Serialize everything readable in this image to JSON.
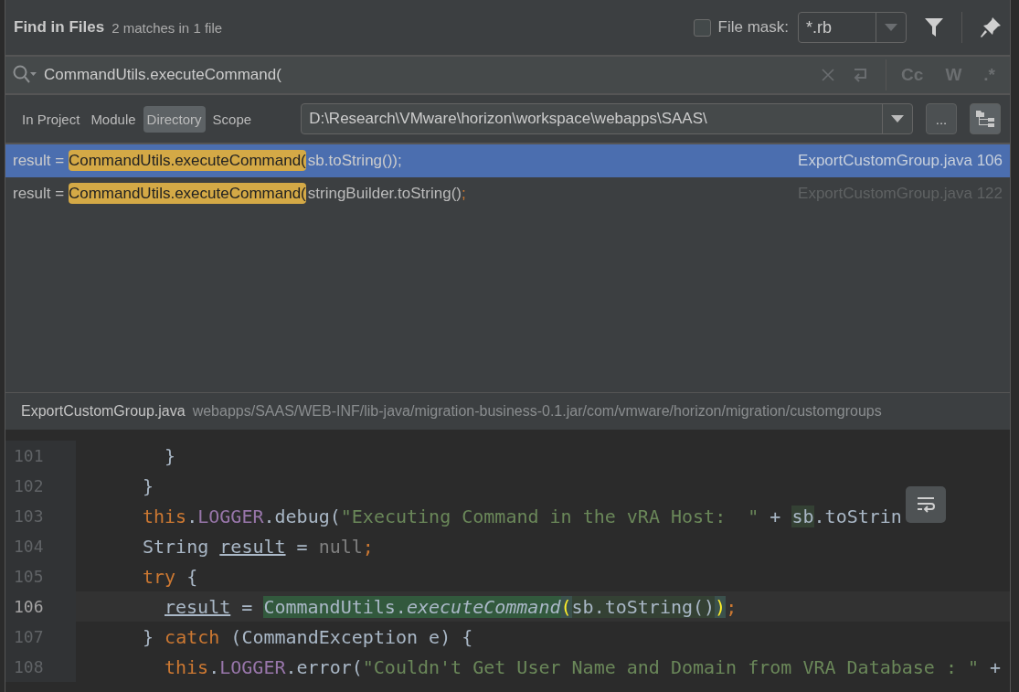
{
  "dialog": {
    "title": "Find in Files",
    "summary": "2 matches in 1 file"
  },
  "file_mask": {
    "checked": false,
    "label": "File mask:",
    "value": "*.rb"
  },
  "search": {
    "value": "CommandUtils.executeCommand(",
    "options": [
      {
        "label": "Cc",
        "selected": false
      },
      {
        "label": "W",
        "selected": false
      },
      {
        "label": ".*",
        "selected": false
      }
    ]
  },
  "scopes": [
    {
      "label": "In Project",
      "selected": false
    },
    {
      "label": "Module",
      "selected": false
    },
    {
      "label": "Directory",
      "selected": true
    },
    {
      "label": "Scope",
      "selected": false
    }
  ],
  "directory": {
    "value": "D:\\Research\\VMware\\horizon\\workspace\\webapps\\SAAS\\",
    "browse_label": "..."
  },
  "results": [
    {
      "prefix": "result = ",
      "match": "CommandUtils.executeCommand(",
      "rest": "sb.toString());",
      "location": "ExportCustomGroup.java 106",
      "selected": true
    },
    {
      "prefix": "result = ",
      "match": "CommandUtils.executeCommand(",
      "rest": "stringBuilder.toString()",
      "tail": ";",
      "location": "ExportCustomGroup.java 122",
      "selected": false
    }
  ],
  "preview": {
    "file": "ExportCustomGroup.java",
    "path": "webapps/SAAS/WEB-INF/lib-java/migration-business-0.1.jar/com/vmware/horizon/migration/customgroups",
    "lines": [
      {
        "number": "101",
        "kind": "inner",
        "current": false,
        "tokens": [
          {
            "kind": "plain",
            "text": "}"
          }
        ]
      },
      {
        "number": "102",
        "kind": "outer",
        "current": false,
        "tokens": [
          {
            "kind": "plain",
            "text": "}"
          }
        ]
      },
      {
        "number": "103",
        "kind": "outer",
        "current": false,
        "tokens": [
          {
            "kind": "kw",
            "text": "this"
          },
          {
            "kind": "plain",
            "text": "."
          },
          {
            "kind": "field",
            "text": "LOGGER"
          },
          {
            "kind": "plain",
            "text": ".debug("
          },
          {
            "kind": "str",
            "text": "\"Executing Command in the vRA Host:  \""
          },
          {
            "kind": "plain",
            "text": " + "
          },
          {
            "kind": "hl",
            "text": "sb"
          },
          {
            "kind": "plain",
            "text": ".toStrin"
          }
        ]
      },
      {
        "number": "104",
        "kind": "outer",
        "current": false,
        "tokens": [
          {
            "kind": "plain",
            "text": "String "
          },
          {
            "kind": "var",
            "text": "result"
          },
          {
            "kind": "plain",
            "text": " = "
          },
          {
            "kind": "null",
            "text": "null"
          },
          {
            "kind": "kw",
            "text": ";"
          }
        ]
      },
      {
        "number": "105",
        "kind": "outer",
        "current": false,
        "tokens": [
          {
            "kind": "kw",
            "text": "try"
          },
          {
            "kind": "plain",
            "text": " {"
          }
        ]
      },
      {
        "number": "106",
        "kind": "inner",
        "current": true,
        "tokens": [
          {
            "kind": "var",
            "text": "result"
          },
          {
            "kind": "plain",
            "text": " = "
          },
          {
            "kind": "match",
            "text": "CommandUtils."
          },
          {
            "kind": "match-italic",
            "text": "executeCommand"
          },
          {
            "kind": "brace",
            "text": "("
          },
          {
            "kind": "hl",
            "text": "sb.toString()"
          },
          {
            "kind": "brace",
            "text": ")"
          },
          {
            "kind": "kw",
            "text": ";"
          }
        ]
      },
      {
        "number": "107",
        "kind": "outer",
        "current": false,
        "tokens": [
          {
            "kind": "plain",
            "text": "} "
          },
          {
            "kind": "kw",
            "text": "catch"
          },
          {
            "kind": "plain",
            "text": " (CommandException e) {"
          }
        ]
      },
      {
        "number": "108",
        "kind": "inner",
        "current": false,
        "tokens": [
          {
            "kind": "kw",
            "text": "this"
          },
          {
            "kind": "plain",
            "text": "."
          },
          {
            "kind": "field",
            "text": "LOGGER"
          },
          {
            "kind": "plain",
            "text": ".error("
          },
          {
            "kind": "str",
            "text": "\"Couldn't Get User Name and Domain from VRA Database : \""
          },
          {
            "kind": "plain",
            "text": " +"
          }
        ]
      }
    ]
  }
}
